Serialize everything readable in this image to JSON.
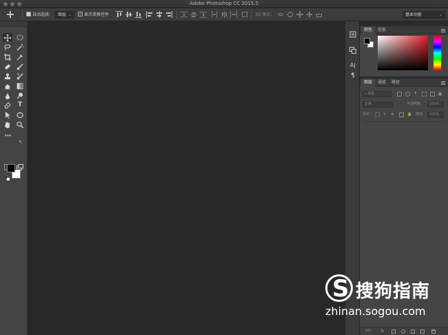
{
  "window": {
    "title": "Adobe Photoshop CC 2015.5"
  },
  "options_bar": {
    "auto_select_label": "自动选择:",
    "auto_select_checked": true,
    "auto_select_target": "图层",
    "show_transform_label": "显示变换控件",
    "show_transform_checked": false,
    "mode_3d_label": "3D 模式:",
    "workspace": "基本功能"
  },
  "tools": [
    "move-tool",
    "marquee-tool",
    "lasso-tool",
    "magic-wand-tool",
    "crop-tool",
    "eyedropper-tool",
    "healing-brush-tool",
    "brush-tool",
    "clone-stamp-tool",
    "history-brush-tool",
    "eraser-tool",
    "gradient-tool",
    "blur-tool",
    "dodge-tool",
    "pen-tool",
    "type-tool",
    "path-selection-tool",
    "ellipse-tool",
    "hand-tool",
    "zoom-tool"
  ],
  "tool_labels": {
    "type": "T",
    "more": "•••"
  },
  "colors": {
    "foreground": "#000000",
    "background": "#ffffff",
    "canvas": "#282828",
    "panel": "#454545"
  },
  "dock": {
    "glyph_type": "A|",
    "glyph_para": "¶"
  },
  "color_panel": {
    "tabs": [
      "颜色",
      "色板"
    ]
  },
  "layers_panel": {
    "tabs": [
      "图层",
      "通道",
      "路径"
    ],
    "filter_placeholder": "类型",
    "blend_mode": "正常",
    "opacity_label": "不透明度:",
    "opacity_value": "100%",
    "lock_label": "锁定:",
    "fill_label": "填充:",
    "fill_value": "100%",
    "link_label": "GO",
    "fx_label": "fx"
  },
  "watermark": {
    "logo_letter": "S",
    "name": "搜狗指南",
    "url": "zhinan.sogou.com"
  }
}
